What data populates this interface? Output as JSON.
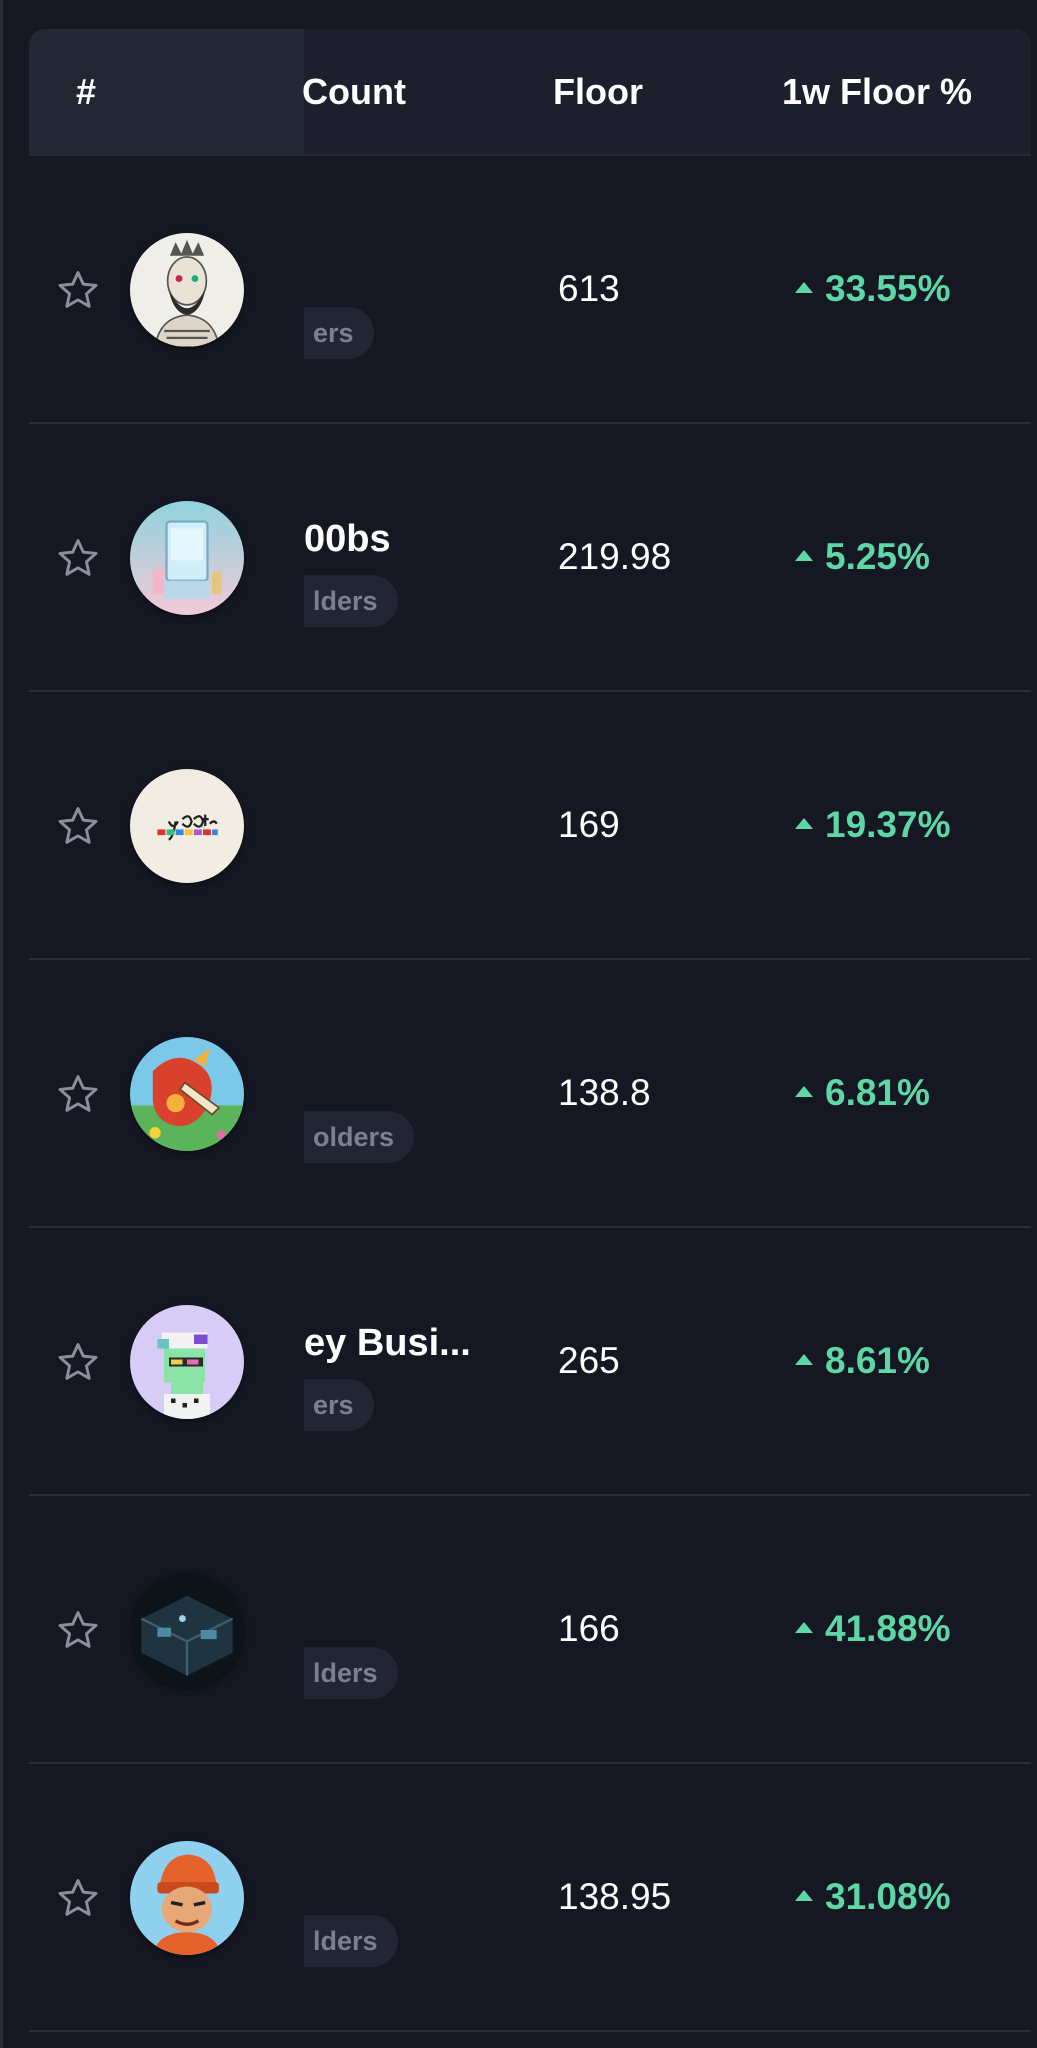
{
  "header": {
    "rank_label": "#",
    "count_label": "Count",
    "floor_label": "Floor",
    "change_label": "1w Floor %"
  },
  "rows": [
    {
      "name": "",
      "holders": "ers",
      "floor": "613",
      "change": "33.55%",
      "avatar_icon": "bearded-skeleton-avatar-icon"
    },
    {
      "name": "00bs",
      "holders": "lders",
      "floor": "219.98",
      "change": "5.25%",
      "avatar_icon": "claw-machine-avatar-icon"
    },
    {
      "name": "",
      "holders": "",
      "floor": "169",
      "change": "19.37%",
      "avatar_icon": "y00ts-logo-avatar-icon"
    },
    {
      "name": "",
      "holders": "olders",
      "floor": "138.8",
      "change": "6.81%",
      "avatar_icon": "dragon-avatar-icon"
    },
    {
      "name": "ey Busi...",
      "holders": "ers",
      "floor": "265",
      "change": "8.61%",
      "avatar_icon": "pixel-character-avatar-icon"
    },
    {
      "name": "",
      "holders": "lders",
      "floor": "166",
      "change": "41.88%",
      "avatar_icon": "dark-room-avatar-icon"
    },
    {
      "name": "",
      "holders": "lders",
      "floor": "138.95",
      "change": "31.08%",
      "avatar_icon": "orange-beanie-character-avatar-icon"
    }
  ],
  "colors": {
    "background": "#151823",
    "header_bg": "#1d202c",
    "positive": "#5ed7a6",
    "muted": "#7b8091"
  }
}
